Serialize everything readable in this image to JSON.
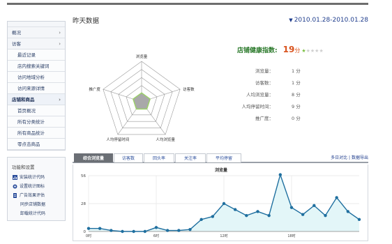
{
  "title": "昨天数据",
  "date_range": "2010.01.28-2010.01.28",
  "sidebar": {
    "items": [
      {
        "label": "概况",
        "level": 0,
        "chev": true
      },
      {
        "label": "访客",
        "level": 0,
        "chev": true
      },
      {
        "label": "最近记录",
        "level": 1
      },
      {
        "label": "店内搜索关键词",
        "level": 1
      },
      {
        "label": "访问地域分析",
        "level": 1
      },
      {
        "label": "访问来源详情",
        "level": 1
      },
      {
        "label": "店铺和商品",
        "level": 0,
        "chev": true,
        "active": true
      },
      {
        "label": "首页概况",
        "level": 1
      },
      {
        "label": "所有分类统计",
        "level": 1
      },
      {
        "label": "所有商品统计",
        "level": 1
      },
      {
        "label": "零点击商品",
        "level": 1
      }
    ]
  },
  "functions": {
    "title": "功能和设置",
    "items": [
      {
        "label": "安装统计代码",
        "icon": "bar-chart-icon"
      },
      {
        "label": "设置统计图标",
        "icon": "gear-icon"
      },
      {
        "label": "广告效果评估",
        "icon": "document-icon"
      },
      {
        "label": "同步店铺数据",
        "icon": ""
      },
      {
        "label": "卸载统计代码",
        "icon": ""
      }
    ]
  },
  "radar": {
    "axes": [
      "浏览量",
      "访客数",
      "人均浏览量",
      "人均停留时间",
      "推广度"
    ],
    "values": [
      1,
      0,
      8,
      9,
      0
    ],
    "max": 100,
    "fill_color": "#9bd06a"
  },
  "health": {
    "label": "店铺健康指数:",
    "score": "19",
    "unit": "分",
    "stars_on": 1,
    "stars_total": 5
  },
  "stats": [
    {
      "label": "浏览量：",
      "value": "1 分"
    },
    {
      "label": "访客数：",
      "value": "1 分"
    },
    {
      "label": "人均浏览量：",
      "value": "8 分"
    },
    {
      "label": "人均停留时间：",
      "value": "9 分"
    },
    {
      "label": "推广度：",
      "value": "0 分"
    }
  ],
  "tabs": [
    "综合浏览量",
    "访客数",
    "回头率",
    "关注率",
    "平均停留"
  ],
  "tab_links": {
    "compare": "多日对比",
    "separator": " | ",
    "export": "数据导出"
  },
  "chart_data": {
    "type": "area",
    "title": "浏览量",
    "x": [
      "0时",
      "1时",
      "2时",
      "3时",
      "4时",
      "5时",
      "6时",
      "7时",
      "8时",
      "9时",
      "10时",
      "11时",
      "12时",
      "13时",
      "14时",
      "15时",
      "16时",
      "17时",
      "18时",
      "19时",
      "20时",
      "21时",
      "22时",
      "23时"
    ],
    "x_tick_labels": [
      "0时",
      "6时",
      "12时",
      "18时"
    ],
    "y_ticks": [
      0,
      28,
      56
    ],
    "ylim": [
      0,
      56
    ],
    "values": [
      3,
      3,
      1,
      0,
      0,
      0,
      4,
      1,
      1,
      2,
      12,
      15,
      28,
      22,
      16,
      20,
      16,
      57,
      24,
      17,
      26,
      16,
      34,
      20,
      12
    ],
    "line_color": "#1f6f9f",
    "fill_color": "#e3f6f8",
    "grid": true
  }
}
